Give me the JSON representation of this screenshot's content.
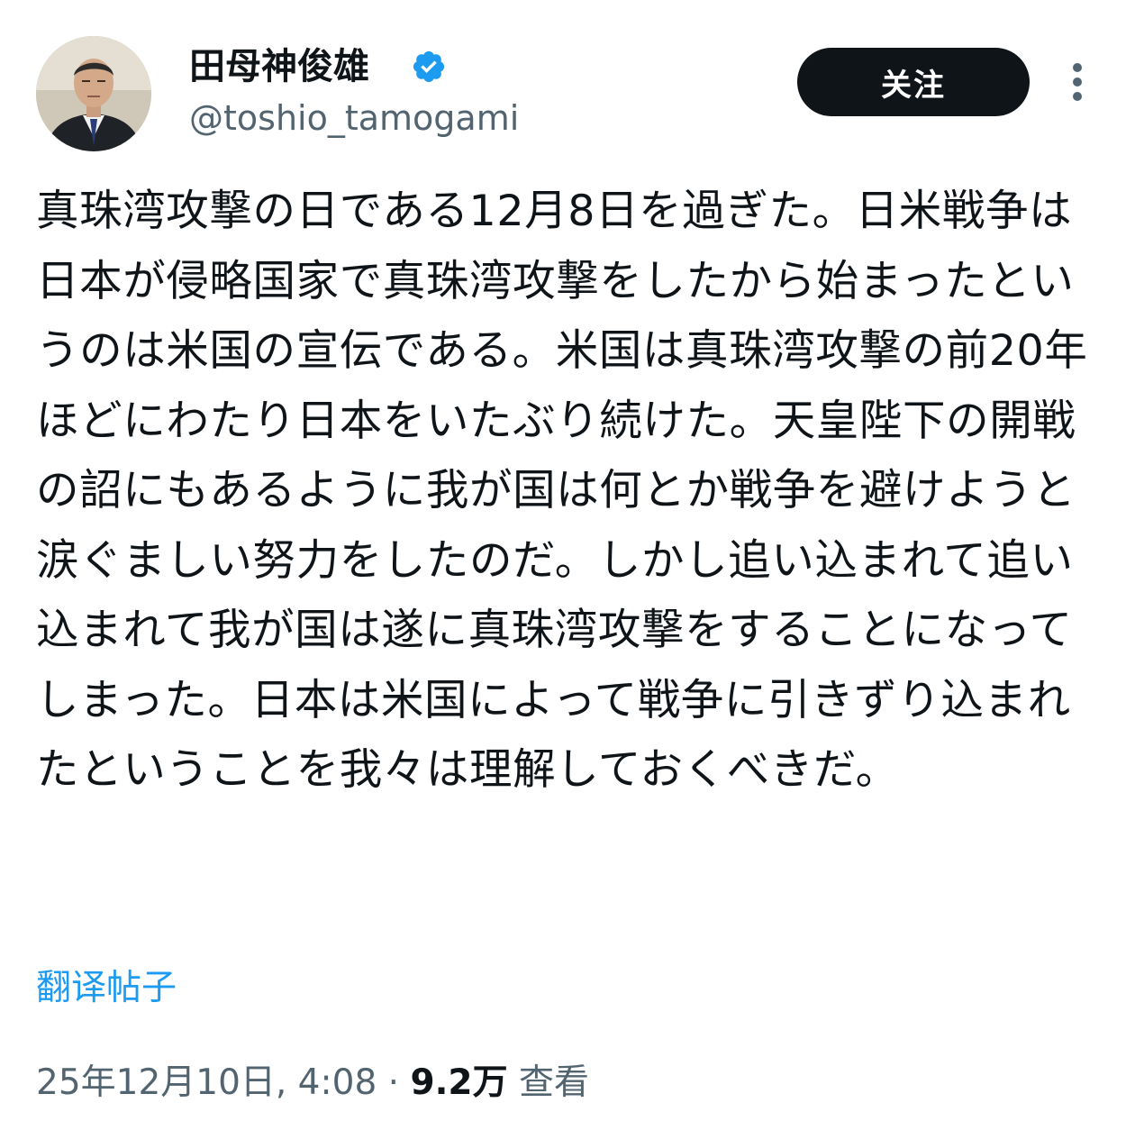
{
  "author": {
    "display_name": "田母神俊雄",
    "handle": "@toshio_tamogami",
    "verified": true,
    "verified_color": "#1d9bf0"
  },
  "actions": {
    "follow_label": "关注",
    "more_icon": "more-vertical-icon"
  },
  "tweet": {
    "text": "真珠湾攻撃の日である12月8日を過ぎた。日米戦争は日本が侵略国家で真珠湾攻撃をしたから始まったというのは米国の宣伝である。米国は真珠湾攻撃の前20年ほどにわたり日本をいたぶり続けた。天皇陛下の開戦の詔にもあるように我が国は何とか戦争を避けようと涙ぐましい努力をしたのだ。しかし追い込まれて追い込まれて我が国は遂に真珠湾攻撃をすることになってしまった。日本は米国によって戦争に引きずり込まれたということを我々は理解しておくべきだ。",
    "translate_label": "翻译帖子"
  },
  "meta": {
    "timestamp": "25年12月10日, 4:08",
    "separator": "·",
    "views_count": "9.2万",
    "views_label": "查看"
  },
  "colors": {
    "text_primary": "#0f1419",
    "text_secondary": "#536471",
    "link": "#1d9bf0",
    "button_bg": "#0f1419",
    "button_text": "#ffffff"
  }
}
